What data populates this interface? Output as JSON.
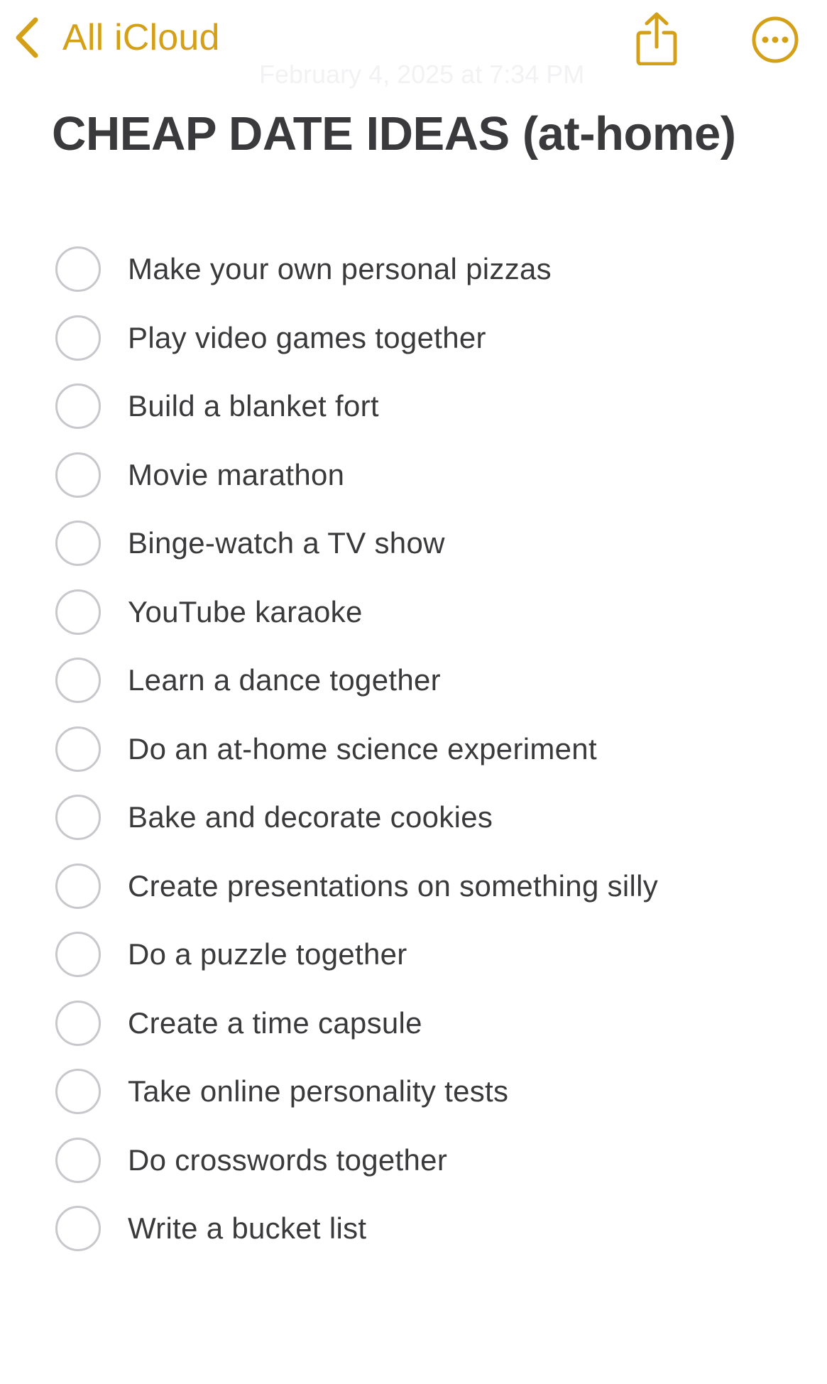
{
  "nav": {
    "back_label": "All iCloud",
    "back_icon": "chevron-left-icon",
    "share_icon": "share-icon",
    "more_icon": "more-ellipsis-icon",
    "accent_color": "#D4A017"
  },
  "note": {
    "date": "February 4, 2025 at 7:34 PM",
    "title": "CHEAP DATE IDEAS (at-home)",
    "items": [
      {
        "label": "Make your own personal pizzas",
        "checked": false
      },
      {
        "label": "Play video games together",
        "checked": false
      },
      {
        "label": "Build a blanket fort",
        "checked": false
      },
      {
        "label": "Movie marathon",
        "checked": false
      },
      {
        "label": "Binge-watch a TV show",
        "checked": false
      },
      {
        "label": "YouTube karaoke",
        "checked": false
      },
      {
        "label": "Learn a dance together",
        "checked": false
      },
      {
        "label": "Do an at-home science experiment",
        "checked": false
      },
      {
        "label": "Bake and decorate cookies",
        "checked": false
      },
      {
        "label": "Create presentations on something silly",
        "checked": false
      },
      {
        "label": "Do a puzzle together",
        "checked": false
      },
      {
        "label": "Create a time capsule",
        "checked": false
      },
      {
        "label": "Take online personality tests",
        "checked": false
      },
      {
        "label": "Do crosswords together",
        "checked": false
      },
      {
        "label": "Write a bucket list",
        "checked": false
      }
    ]
  }
}
